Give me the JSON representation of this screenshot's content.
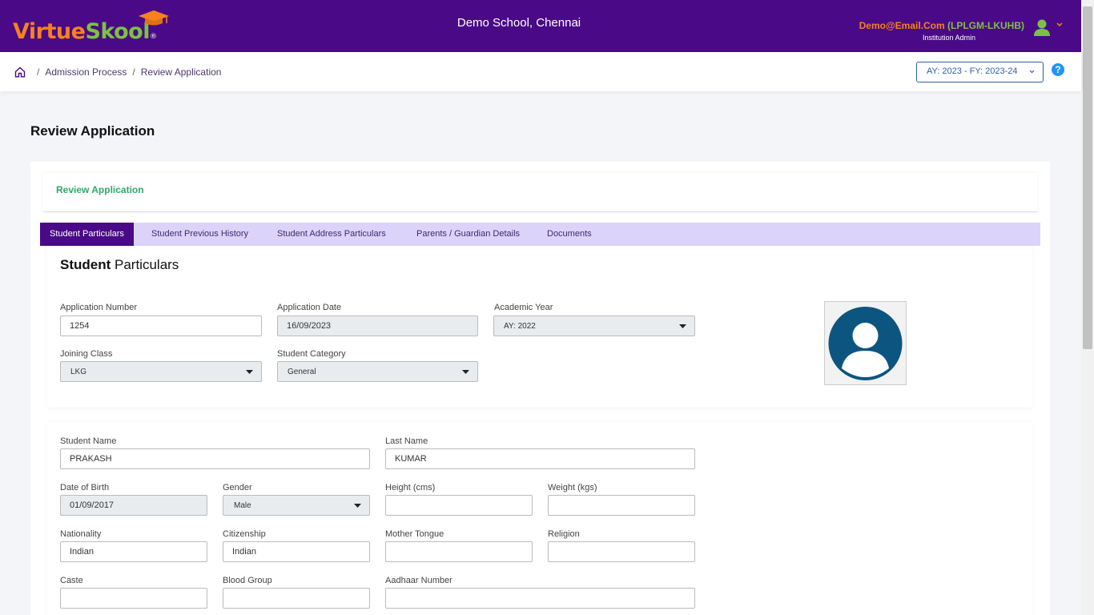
{
  "header": {
    "logo_virtue": "Virtue",
    "logo_skool": "Skool",
    "logo_reg": "®",
    "school_name": "Demo School, Chennai",
    "user_email": "Demo@Email.Com",
    "user_code": "(LPLGM-LKUHB)",
    "user_role": "Institution Admin",
    "colors": {
      "bar": "#4a0a87",
      "email": "#f5821f",
      "code": "#7cc242"
    }
  },
  "breadcrumb": {
    "items": [
      "Admission Process",
      "Review Application"
    ],
    "separator": "/"
  },
  "academic_year_selector": "AY: 2023 - FY: 2023-24",
  "help_label": "?",
  "page_title": "Review Application",
  "card_header": "Review Application",
  "tabs": [
    {
      "label": "Student Particulars",
      "active": true
    },
    {
      "label": "Student Previous History",
      "active": false
    },
    {
      "label": "Student Address Particulars",
      "active": false
    },
    {
      "label": "Parents / Guardian Details",
      "active": false
    },
    {
      "label": "Documents",
      "active": false
    }
  ],
  "section_title": {
    "bold": "Student",
    "rest": " Particulars"
  },
  "form": {
    "application_number": {
      "label": "Application Number",
      "value": "1254"
    },
    "application_date": {
      "label": "Application Date",
      "value": "16/09/2023"
    },
    "academic_year": {
      "label": "Academic Year",
      "value": "AY: 2022"
    },
    "joining_class": {
      "label": "Joining Class",
      "value": "LKG"
    },
    "student_category": {
      "label": "Student Category",
      "value": "General"
    },
    "student_name": {
      "label": "Student Name",
      "value": "PRAKASH"
    },
    "last_name": {
      "label": "Last Name",
      "value": "KUMAR"
    },
    "date_of_birth": {
      "label": "Date of Birth",
      "value": "01/09/2017"
    },
    "gender": {
      "label": "Gender",
      "value": "Male"
    },
    "height": {
      "label": "Height (cms)",
      "value": ""
    },
    "weight": {
      "label": "Weight (kgs)",
      "value": ""
    },
    "nationality": {
      "label": "Nationality",
      "value": "Indian"
    },
    "citizenship": {
      "label": "Citizenship",
      "value": "Indian"
    },
    "mother_tongue": {
      "label": "Mother Tongue",
      "value": ""
    },
    "religion": {
      "label": "Religion",
      "value": ""
    },
    "caste": {
      "label": "Caste",
      "value": ""
    },
    "blood_group": {
      "label": "Blood Group",
      "value": ""
    },
    "aadhaar_number": {
      "label": "Aadhaar Number",
      "value": ""
    }
  },
  "icons": {
    "home": "home-icon",
    "avatar": "user-avatar-icon",
    "help": "help-icon",
    "student_photo": "student-photo-placeholder-icon"
  }
}
